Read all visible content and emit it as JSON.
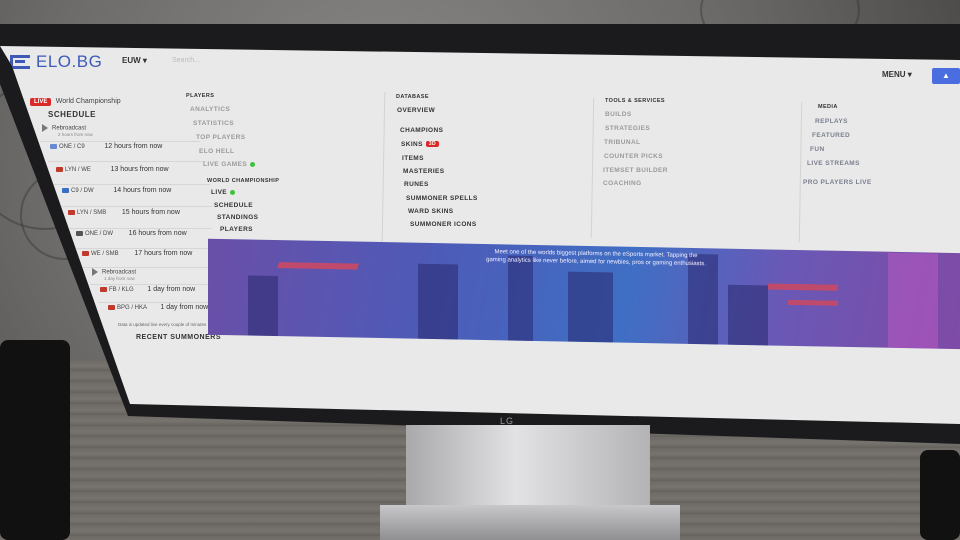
{
  "topbar": {
    "logo": "ELO.BG",
    "region": "EUW",
    "search_placeholder": "Search...",
    "menu_label": "MENU"
  },
  "sidebar": {
    "live_badge": "LIVE",
    "live_link": "World Championship",
    "schedule_title": "SCHEDULE",
    "rows": [
      {
        "teams": "Rebroadcast",
        "sub": "2 hours from now",
        "time": ""
      },
      {
        "teams": "ONE / C9",
        "sub": "",
        "time": "12 hours from now"
      },
      {
        "teams": "LYN / WE",
        "sub": "",
        "time": "13 hours from now"
      },
      {
        "teams": "C9 / DW",
        "sub": "",
        "time": "14 hours from now"
      },
      {
        "teams": "LYN / SMB",
        "sub": "",
        "time": "15 hours from now"
      },
      {
        "teams": "ONE / DW",
        "sub": "",
        "time": "16 hours from now"
      },
      {
        "teams": "WE / SMB",
        "sub": "",
        "time": "17 hours from now"
      },
      {
        "teams": "Rebroadcast",
        "sub": "1 day from now",
        "time": ""
      },
      {
        "teams": "FB / KLG",
        "sub": "",
        "time": "1 day from now"
      },
      {
        "teams": "BPG / HKA",
        "sub": "",
        "time": "1 day from now"
      }
    ],
    "note": "Data is updated live every couple of minutes",
    "recent_title": "RECENT SUMMONERS"
  },
  "menu": {
    "players": {
      "heading": "PLAYERS",
      "items": [
        "ANALYTICS",
        "STATISTICS",
        "TOP PLAYERS",
        "ELO HELL",
        "LIVE GAMES"
      ]
    },
    "world_championship": {
      "heading": "WORLD CHAMPIONSHIP",
      "items": [
        "LIVE",
        "SCHEDULE",
        "STANDINGS",
        "PLAYERS"
      ]
    },
    "database": {
      "heading": "DATABASE",
      "items": [
        "OVERVIEW",
        "CHAMPIONS",
        "SKINS",
        "ITEMS",
        "MASTERIES",
        "RUNES",
        "SUMMONER SPELLS",
        "WARD SKINS",
        "SUMMONER ICONS"
      ],
      "skins_badge": "3D"
    },
    "tools": {
      "heading": "TOOLS & SERVICES",
      "items": [
        "BUILDS",
        "STRATEGIES",
        "TRIBUNAL",
        "COUNTER PICKS",
        "ITEMSET BUILDER",
        "COACHING"
      ]
    },
    "media": {
      "heading": "MEDIA",
      "items": [
        "REPLAYS",
        "FEATURED",
        "FUN",
        "LIVE STREAMS",
        "PRO PLAYERS LIVE"
      ]
    }
  },
  "banner": {
    "text": "Meet one of the worlds biggest platforms on the eSports market. Tapping the gaming analytics like never before, aimed for newbies, pros or gaming enthusiasts."
  },
  "monitor_brand": "LG"
}
